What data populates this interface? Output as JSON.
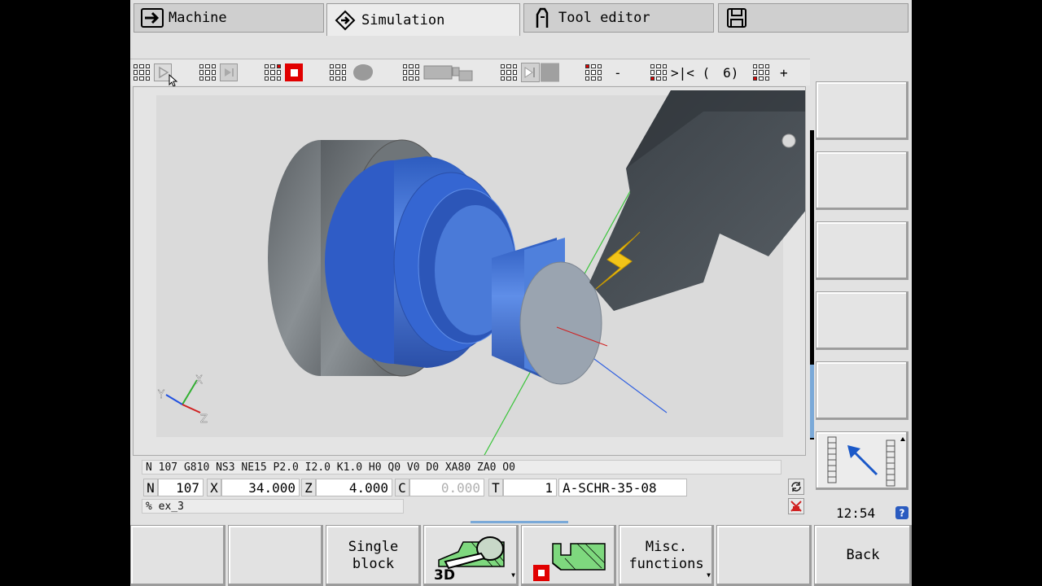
{
  "tabs": [
    {
      "label": "Machine",
      "icon": "arrow-right-icon"
    },
    {
      "label": "Simulation",
      "icon": "diamond-arrow-icon"
    },
    {
      "label": "Tool editor",
      "icon": "tool-icon"
    },
    {
      "label": "",
      "icon": "save-disk-icon"
    }
  ],
  "toolbar": {
    "minus_label": "-",
    "interrupt_label": ">|< (",
    "interrupt_value": "6)",
    "plus_label": "+"
  },
  "nc": {
    "block_line": "N 107    G810 NS3 NE15 P2.0 I2.0 K1.0 H0 Q0 V0 D0 XA80 ZA0 O0",
    "n_label": "N",
    "n_value": "107",
    "x_label": "X",
    "x_value": "34.000",
    "z_label": "Z",
    "z_value": "4.000",
    "c_label": "C",
    "c_value": "0.000",
    "t_label": "T",
    "t_value": "1",
    "tool_id": "A-SCHR-35-08",
    "program": "% ex_3"
  },
  "axes": {
    "x": "X",
    "y": "Y",
    "z": "Z"
  },
  "clock": "12:54",
  "softkeys_bottom": [
    {
      "label": ""
    },
    {
      "label": ""
    },
    {
      "label": "Single\nblock"
    },
    {
      "label": "3D"
    },
    {
      "label": ""
    },
    {
      "label": "Misc.\nfunctions"
    },
    {
      "label": ""
    },
    {
      "label": "Back"
    }
  ],
  "colors": {
    "workpiece": "#3c6ed0",
    "chuck": "#6e7478",
    "insert": "#f2c418",
    "accent": "#7aa9d8",
    "stop": "#e10000"
  }
}
